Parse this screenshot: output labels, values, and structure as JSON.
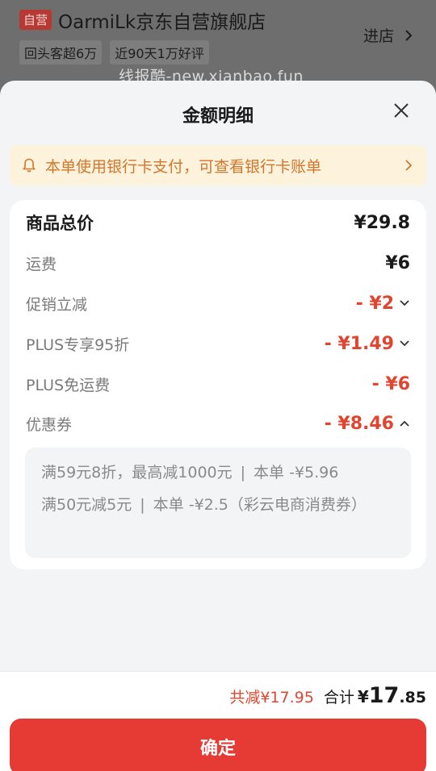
{
  "store": {
    "self_badge": "自营",
    "name": "OarmiLk京东自营旗舰店",
    "enter": "进店",
    "tags": [
      "回头客超6万",
      "近90天1万好评"
    ],
    "watermark": "线报酷-new.xianbao.fun"
  },
  "sheet": {
    "title": "金额明细",
    "notice": "本单使用银行卡支付，可查看银行卡账单"
  },
  "details": {
    "goods_total_label": "商品总价",
    "goods_total_value": "¥29.8",
    "shipping_label": "运费",
    "shipping_value": "¥6",
    "promo_label": "促销立减",
    "promo_value": "- ¥2",
    "plus95_label": "PLUS专享95折",
    "plus95_value": "- ¥1.49",
    "plus_free_ship_label": "PLUS免运费",
    "plus_free_ship_value": "- ¥6",
    "coupon_label": "优惠券",
    "coupon_value": "- ¥8.46"
  },
  "coupons": [
    {
      "rule": "满59元8折，最高减1000元",
      "sep": "|",
      "detail": "本单 -¥5.96"
    },
    {
      "rule": "满50元减5元",
      "sep": "|",
      "detail": "本单 -¥2.5（彩云电商消费券）"
    }
  ],
  "footer": {
    "reduced": "共减¥17.95",
    "total_label": "合计",
    "yen": "¥",
    "total_int": "17",
    "total_dec": ".85",
    "confirm": "确定"
  },
  "colors": {
    "accent_red": "#e63a35",
    "price_red": "#e2452f",
    "notice_bg": "#fdf3dd",
    "notice_text": "#d2762b"
  }
}
